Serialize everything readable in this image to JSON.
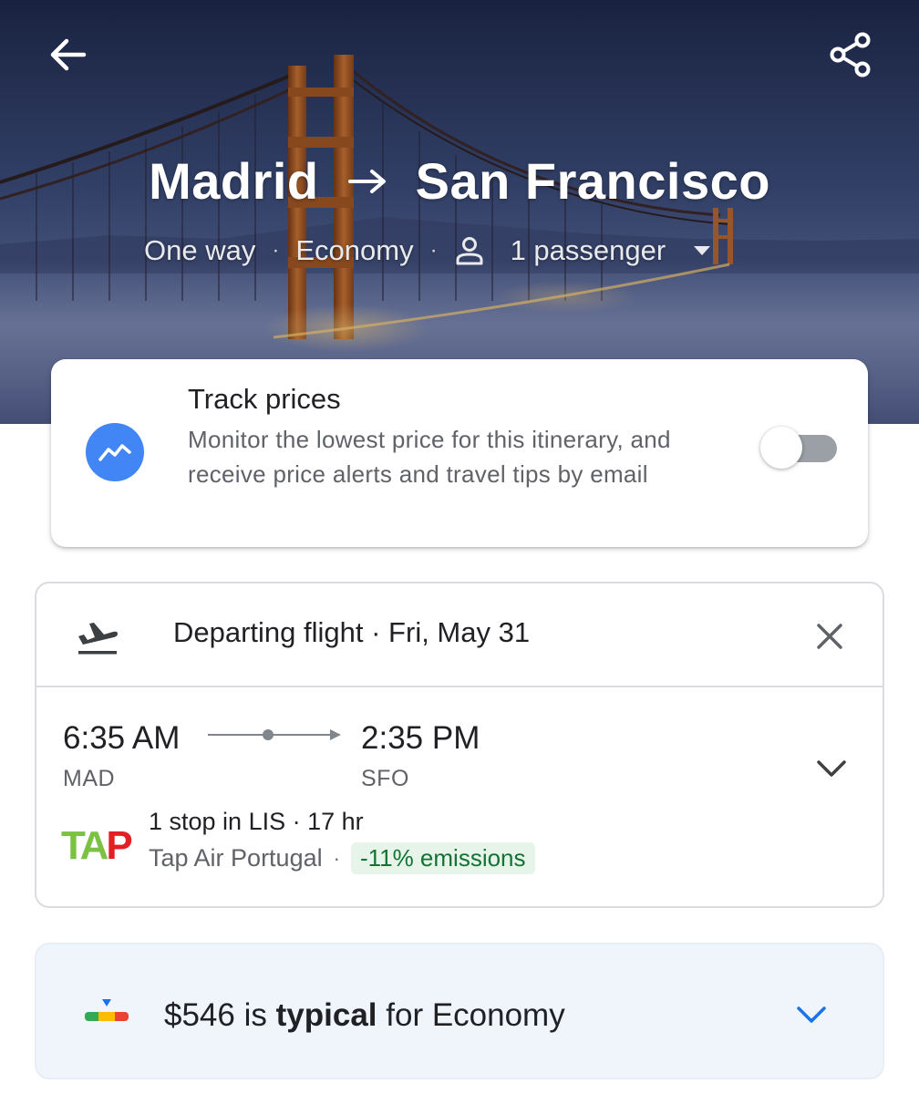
{
  "header": {
    "origin": "Madrid",
    "destination": "San Francisco",
    "trip_type": "One way",
    "cabin": "Economy",
    "passengers": "1 passenger",
    "icons": [
      "back-arrow-icon",
      "share-icon",
      "route-arrow-icon",
      "person-icon",
      "dropdown-caret-icon"
    ]
  },
  "track_prices": {
    "title": "Track prices",
    "description": "Monitor the lowest price for this itinerary, and receive price alerts and travel tips by email",
    "enabled": false,
    "icon": "trend-line-icon",
    "accent_color": "#4285f4"
  },
  "flight": {
    "header_title": "Departing flight · Fri, May 31",
    "depart_time": "6:35 AM",
    "arrive_time": "2:35 PM",
    "depart_code": "MAD",
    "arrive_code": "SFO",
    "stops": "1 stop in LIS · 17 hr",
    "airline": "Tap Air Portugal",
    "emissions": "-11% emissions",
    "airline_logo_text": "TAP",
    "emissions_color": "#137333",
    "icons": [
      "departure-plane-icon",
      "close-icon",
      "chevron-down-icon"
    ]
  },
  "price_insight": {
    "price": "$546",
    "is_label": "is",
    "level": "typical",
    "suffix": "for Economy",
    "icon": "price-gauge-icon",
    "chevron_color": "#1a73e8"
  }
}
